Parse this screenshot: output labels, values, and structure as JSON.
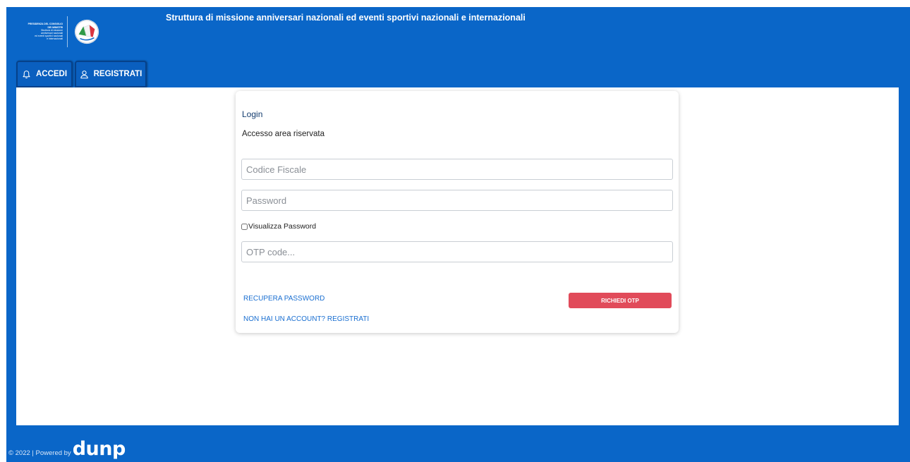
{
  "header": {
    "logo_lines": [
      "PRESIDENZA DEL CONSIGLIO",
      "DEI MINISTRI",
      "Struttura di missione",
      "anniversari nazionali",
      "ed eventi sportivi nazionali",
      "e internazionali"
    ],
    "site_title": "Struttura di missione anniversari nazionali ed eventi sportivi nazionali e internazionali"
  },
  "tabs": [
    {
      "label": "ACCEDI",
      "icon": "bell-icon"
    },
    {
      "label": "REGISTRATI",
      "icon": "user-icon"
    }
  ],
  "login": {
    "title": "Login",
    "subtitle": "Accesso area riservata",
    "codice_fiscale": {
      "value": "",
      "placeholder": "Codice Fiscale"
    },
    "password": {
      "value": "",
      "placeholder": "Password"
    },
    "show_password_label": "Visualizza Password",
    "show_password_checked": false,
    "otp": {
      "value": "",
      "placeholder": "OTP code..."
    },
    "recover_link": "RECUPERA PASSWORD",
    "register_link": "NON HAI UN ACCOUNT? REGISTRATI",
    "request_otp_button": "RICHIEDI OTP"
  },
  "footer": {
    "copyright": "© 2022 | Powered by",
    "brand": "dunp"
  },
  "colors": {
    "header_blue": "#0a66c8",
    "tab_border": "#06418a",
    "button_red": "#e14b5a",
    "link_blue": "#1a6fd1",
    "title_navy": "#123b6e"
  }
}
